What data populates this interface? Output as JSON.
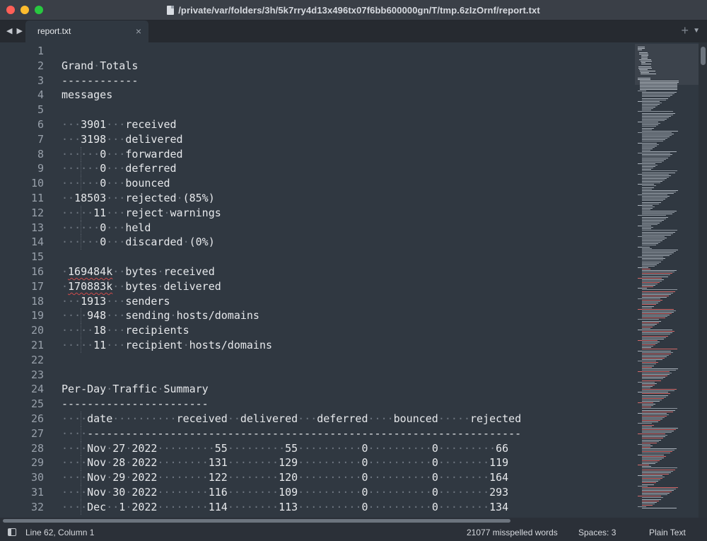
{
  "window": {
    "title": "/private/var/folders/3h/5k7rry4d13x496tx07f6bb600000gn/T/tmp.6zIzOrnf/report.txt"
  },
  "tabs": [
    {
      "label": "report.txt",
      "active": true
    }
  ],
  "toolbar": {
    "add_tab_icon": "plus-icon",
    "tab_menu_icon": "chevron-down-icon"
  },
  "editor": {
    "line_numbers": [
      "1",
      "2",
      "3",
      "4",
      "5",
      "6",
      "7",
      "8",
      "9",
      "10",
      "11",
      "12",
      "13",
      "14",
      "15",
      "16",
      "17",
      "18",
      "19",
      "20",
      "21",
      "22",
      "23",
      "24",
      "25",
      "26",
      "27",
      "28",
      "29",
      "30",
      "31",
      "32"
    ],
    "lines": [
      "",
      "Grand Totals",
      "------------",
      "messages",
      "",
      "   3901   received",
      "   3198   delivered",
      "      0   forwarded",
      "      0   deferred",
      "      0   bounced",
      "  18503   rejected (85%)",
      "     11   reject warnings",
      "      0   held",
      "      0   discarded (0%)",
      "",
      " 169484k  bytes received",
      " 170883k  bytes delivered",
      "   1913   senders",
      "    948   sending hosts/domains",
      "     18   recipients",
      "     11   recipient hosts/domains",
      "",
      "",
      "Per-Day Traffic Summary",
      "-----------------------",
      "    date          received  delivered   deferred    bounced     rejected",
      "    --------------------------------------------------------------------",
      "    Nov 27 2022         55         55          0          0         66",
      "    Nov 28 2022        131        129          0          0        119",
      "    Nov 29 2022        122        120          0          0        164",
      "    Nov 30 2022        116        109          0          0        293",
      "    Dec  1 2022        114        113          0          0        134"
    ]
  },
  "statusbar": {
    "position": "Line 62, Column 1",
    "spelling": "21077 misspelled words",
    "indent": "Spaces: 3",
    "syntax": "Plain Text"
  },
  "colors": {
    "background": "#303841",
    "text": "#e6e8eb",
    "whitespace_dots": "#6d757f",
    "line_numbers": "#98a0aa",
    "spell_error": "#d14b4b"
  }
}
